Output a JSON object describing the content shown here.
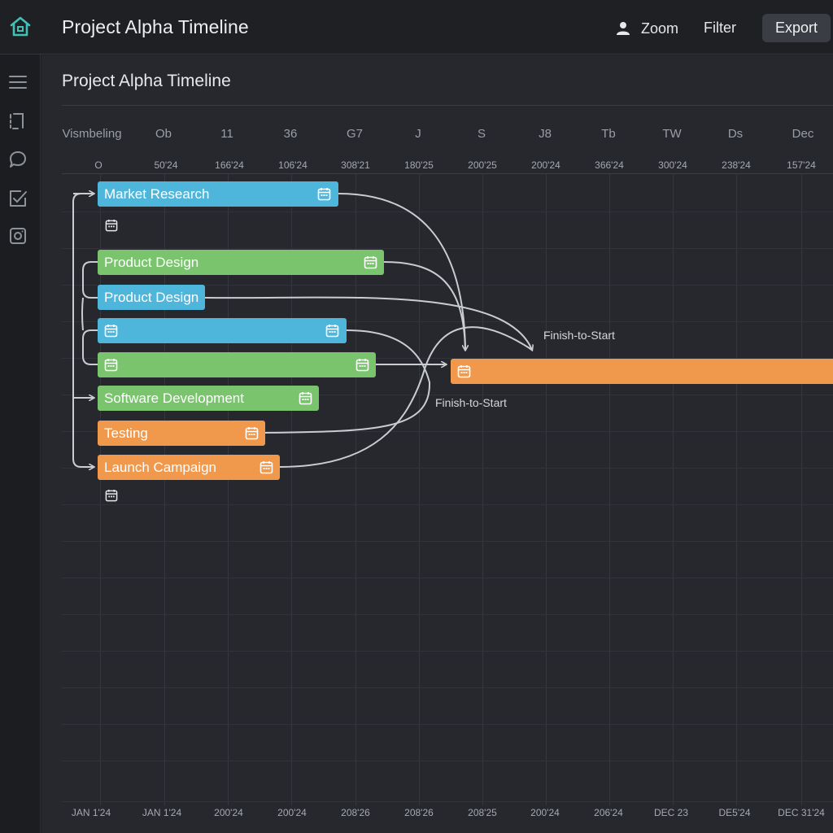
{
  "header": {
    "app_title": "Project Alpha Timeline",
    "zoom_label": "Zoom",
    "filter_label": "Filter",
    "export_label": "Export"
  },
  "sidebar": {
    "items": [
      {
        "icon": "menu-icon"
      },
      {
        "icon": "bookmark-icon"
      },
      {
        "icon": "chat-icon"
      },
      {
        "icon": "checkbox-icon"
      },
      {
        "icon": "camera-icon"
      }
    ]
  },
  "panel": {
    "title": "Project Alpha Timeline"
  },
  "timeline": {
    "months": [
      "Vismbeling",
      "Ob",
      "11",
      "36",
      "G7",
      "J",
      "S",
      "J8",
      "Tb",
      "TW",
      "Ds",
      "Dec"
    ],
    "dates": [
      "O",
      "50'24",
      "166'24",
      "106'24",
      "308'21",
      "180'25",
      "200'25",
      "200'24",
      "366'24",
      "300'24",
      "238'24",
      "157'24"
    ],
    "footer": [
      "JAN 1'24",
      "JAN 1'24",
      "200'24",
      "200'24",
      "208'26",
      "208'26",
      "208'25",
      "200'24",
      "206'24",
      "DEC 23",
      "DE5'24",
      "DEC 31'24"
    ]
  },
  "tasks": [
    {
      "label": "Market Research",
      "color": "#4fb6db"
    },
    {
      "label": "Product Design",
      "color": "#79c46d"
    },
    {
      "label": "Product Design",
      "color": "#4fb6db"
    },
    {
      "label": "",
      "color": "#4fb6db"
    },
    {
      "label": "",
      "color": "#79c46d"
    },
    {
      "label": "Software Development",
      "color": "#79c46d"
    },
    {
      "label": "Testing",
      "color": "#f0984c"
    },
    {
      "label": "Launch Campaign",
      "color": "#f0984c"
    },
    {
      "label": "",
      "color": "#f0984c"
    }
  ],
  "dependencies": [
    {
      "label": "Finish-to-Start"
    },
    {
      "label": "Finish-to-Start"
    }
  ],
  "colors": {
    "accent": "#3fc1b5",
    "blue": "#4fb6db",
    "green": "#79c46d",
    "orange": "#f0984c",
    "background": "#26282d"
  }
}
